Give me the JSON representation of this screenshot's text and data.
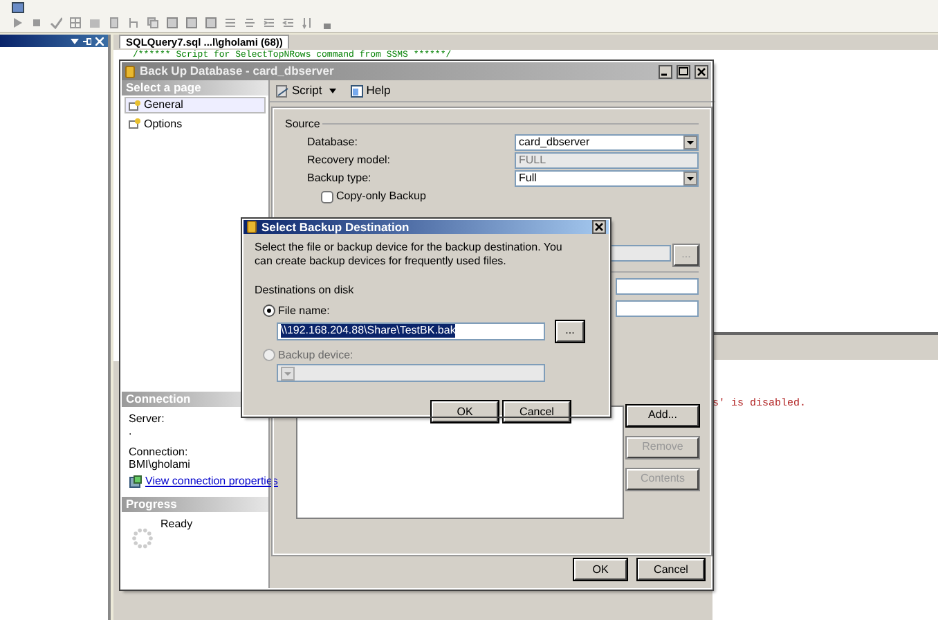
{
  "editor": {
    "tab": "SQLQuery7.sql ...l\\gholami (68))",
    "code_line": "/****** Script for SelectTopNRows command from SSMS  ******/",
    "message": "s' is disabled."
  },
  "backup_dialog": {
    "title": "Back Up Database - card_dbserver",
    "active": false,
    "select_page_header": "Select a page",
    "pages": [
      {
        "label": "General",
        "selected": true
      },
      {
        "label": "Options",
        "selected": false
      }
    ],
    "toolbar": [
      "Script",
      "Help"
    ],
    "connection": {
      "header": "Connection",
      "server_label": "Server:",
      "server": ".",
      "connection_label": "Connection:",
      "connection": "BMI\\gholami",
      "link": "View connection properties"
    },
    "progress": {
      "header": "Progress",
      "status": "Ready"
    },
    "source": {
      "legend": "Source",
      "fields": [
        {
          "label": "Database:",
          "value": "card_dbserver",
          "disabled": false
        },
        {
          "label": "Recovery model:",
          "value": "FULL",
          "disabled": true
        },
        {
          "label": "Backup type:",
          "value": "Full",
          "disabled": false
        }
      ],
      "copy_only": {
        "label": "Copy-only Backup",
        "checked": false
      }
    },
    "browse": "...",
    "destination_buttons": [
      {
        "label": "Add...",
        "disabled": false
      },
      {
        "label": "Remove",
        "disabled": true
      },
      {
        "label": "Contents",
        "disabled": true
      }
    ],
    "buttons": [
      "OK",
      "Cancel"
    ]
  },
  "destination_dialog": {
    "title": "Select Backup Destination",
    "active": true,
    "description": "Select the file or backup device for the backup destination. You can create backup devices for frequently used files.",
    "group_label": "Destinations on disk",
    "options": [
      {
        "label": "File name:",
        "selected": true
      },
      {
        "label": "Backup device:",
        "selected": false
      }
    ],
    "file_name": "\\\\192.168.204.88\\Share\\TestBK.bak",
    "browse": "...",
    "buttons": [
      "OK",
      "Cancel"
    ]
  }
}
